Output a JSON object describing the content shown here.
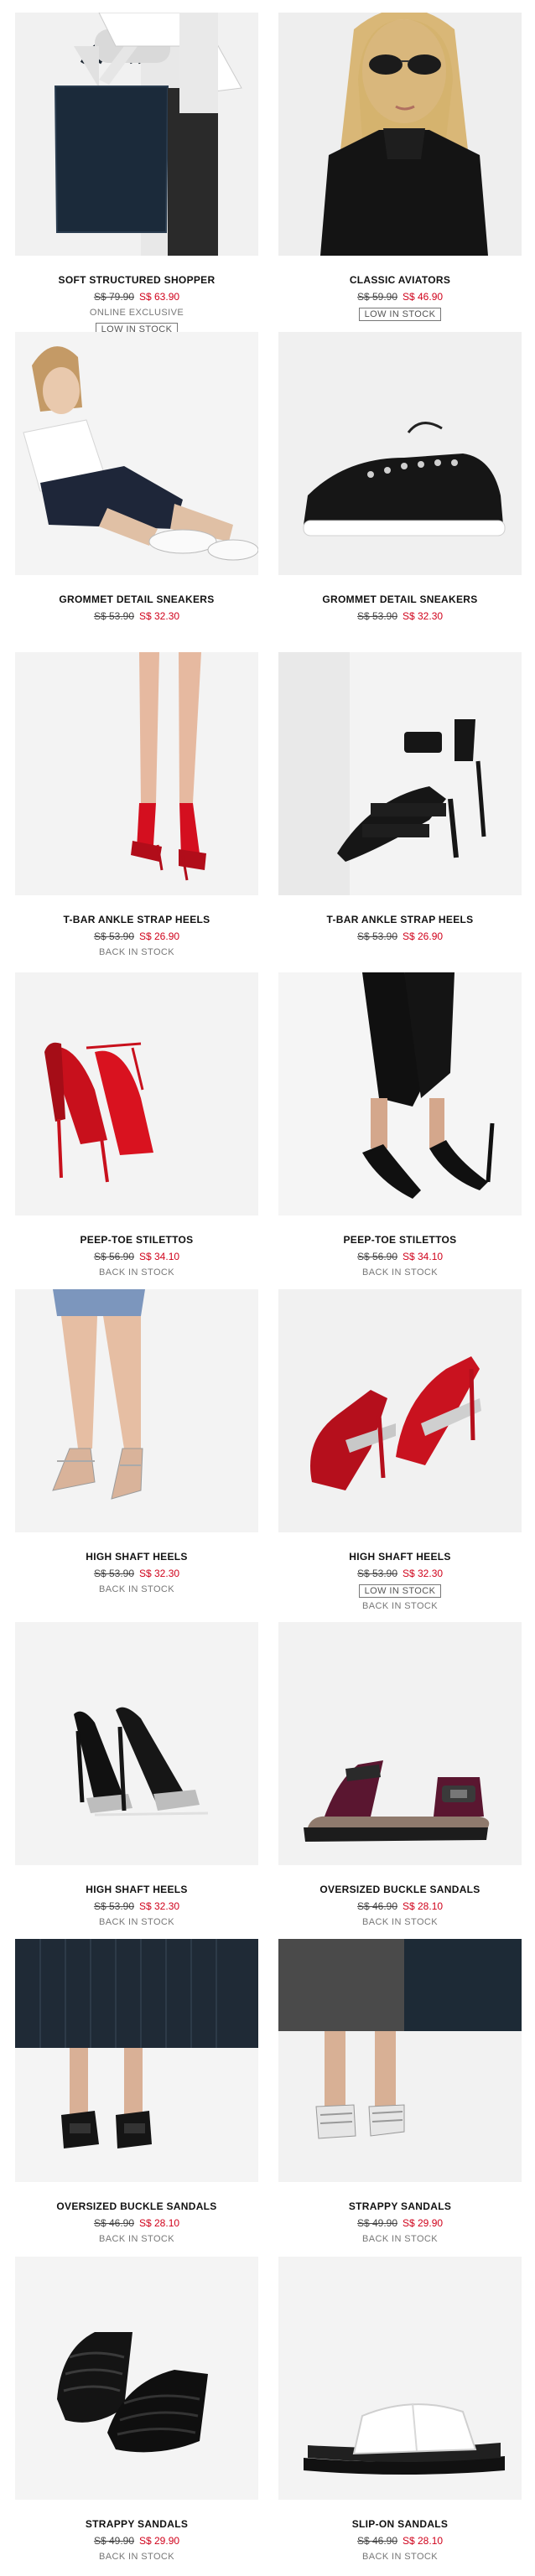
{
  "products": [
    {
      "name": "SOFT STRUCTURED SHOPPER",
      "old_price": "S$ 79.90",
      "new_price": "S$ 63.90",
      "note": "ONLINE EXCLUSIVE",
      "badge": "LOW IN STOCK",
      "image": "shopper-bag"
    },
    {
      "name": "CLASSIC AVIATORS",
      "old_price": "S$ 59.90",
      "new_price": "S$ 46.90",
      "badge": "LOW IN STOCK",
      "image": "aviator-sunglasses"
    },
    {
      "name": "GROMMET DETAIL SNEAKERS",
      "old_price": "S$ 53.90",
      "new_price": "S$ 32.30",
      "image": "sneakers-model"
    },
    {
      "name": "GROMMET DETAIL SNEAKERS",
      "old_price": "S$ 53.90",
      "new_price": "S$ 32.30",
      "image": "sneakers-black"
    },
    {
      "name": "T-BAR ANKLE STRAP HEELS",
      "old_price": "S$ 53.90",
      "new_price": "S$ 26.90",
      "note": "BACK IN STOCK",
      "image": "red-ankle-heels"
    },
    {
      "name": "T-BAR ANKLE STRAP HEELS",
      "old_price": "S$ 53.90",
      "new_price": "S$ 26.90",
      "image": "black-ankle-heels"
    },
    {
      "name": "PEEP-TOE STILETTOS",
      "old_price": "S$ 56.90",
      "new_price": "S$ 34.10",
      "note": "BACK IN STOCK",
      "image": "red-peep-toe"
    },
    {
      "name": "PEEP-TOE STILETTOS",
      "old_price": "S$ 56.90",
      "new_price": "S$ 34.10",
      "note": "BACK IN STOCK",
      "image": "black-peep-toe"
    },
    {
      "name": "HIGH SHAFT HEELS",
      "old_price": "S$ 53.90",
      "new_price": "S$ 32.30",
      "note": "BACK IN STOCK",
      "image": "model-high-shaft"
    },
    {
      "name": "HIGH SHAFT HEELS",
      "old_price": "S$ 53.90",
      "new_price": "S$ 32.30",
      "badge": "LOW IN STOCK",
      "note": "BACK IN STOCK",
      "image": "red-high-shaft"
    },
    {
      "name": "HIGH SHAFT HEELS",
      "old_price": "S$ 53.90",
      "new_price": "S$ 32.30",
      "note": "BACK IN STOCK",
      "image": "black-high-shaft"
    },
    {
      "name": "OVERSIZED BUCKLE SANDALS",
      "old_price": "S$ 46.90",
      "new_price": "S$ 28.10",
      "note": "BACK IN STOCK",
      "image": "burgundy-sandals"
    },
    {
      "name": "OVERSIZED BUCKLE SANDALS",
      "old_price": "S$ 46.90",
      "new_price": "S$ 28.10",
      "note": "BACK IN STOCK",
      "image": "model-buckle-sandals"
    },
    {
      "name": "STRAPPY SANDALS",
      "old_price": "S$ 49.90",
      "new_price": "S$ 29.90",
      "note": "BACK IN STOCK",
      "image": "model-strappy-sandals"
    },
    {
      "name": "STRAPPY SANDALS",
      "old_price": "S$ 49.90",
      "new_price": "S$ 29.90",
      "note": "BACK IN STOCK",
      "image": "black-strappy-sandals"
    },
    {
      "name": "SLIP-ON SANDALS",
      "old_price": "S$ 46.90",
      "new_price": "S$ 28.10",
      "note": "BACK IN STOCK",
      "image": "white-slip-on"
    }
  ],
  "colors": {
    "sale": "#d0021b",
    "background": "#ffffff",
    "image_bg": "#f2f2f2"
  }
}
